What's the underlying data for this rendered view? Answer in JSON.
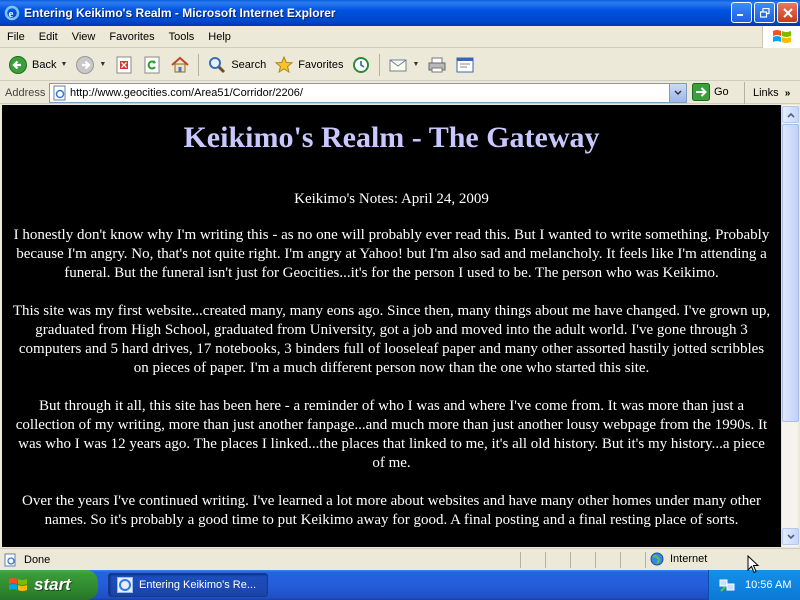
{
  "window": {
    "title": "Entering Keikimo's Realm - Microsoft Internet Explorer"
  },
  "menu": {
    "items": [
      "File",
      "Edit",
      "View",
      "Favorites",
      "Tools",
      "Help"
    ]
  },
  "toolbar": {
    "back_label": "Back",
    "search_label": "Search",
    "favorites_label": "Favorites"
  },
  "address": {
    "label": "Address",
    "url": "http://www.geocities.com/Area51/Corridor/2206/",
    "go_label": "Go",
    "links_label": "Links"
  },
  "page": {
    "heading": "Keikimo's Realm - The Gateway",
    "notes_date": "Keikimo's Notes: April 24, 2009",
    "paragraphs": [
      "I honestly don't know why I'm writing this - as no one will probably ever read this. But I wanted to write something. Probably because I'm angry. No, that's not quite right. I'm angry at Yahoo! but I'm also sad and melancholy. It feels like I'm attending a funeral. But the funeral isn't just for Geocities...it's for the person I used to be. The person who was Keikimo.",
      "This site was my first website...created many, many eons ago. Since then, many things about me have changed. I've grown up, graduated from High School, graduated from University, got a job and moved into the adult world. I've gone through 3 computers and 5 hard drives, 17 notebooks, 3 binders full of looseleaf paper and many other assorted hastily jotted scribbles on pieces of paper. I'm a much different person now than the one who started this site.",
      "But through it all, this site has been here - a reminder of who I was and where I've come from. It was more than just a collection of my writing, more than just another fanpage...and much more than just another lousy webpage from the 1990s. It was who I was 12 years ago. The places I linked...the places that linked to me, it's all old history. But it's my history...a piece of me.",
      "Over the years I've continued writing. I've learned a lot more about websites and have many other homes under many other names. So it's probably a good time to put Keikimo away for good. A final posting and a final resting place of sorts."
    ]
  },
  "status": {
    "text": "Done",
    "zone": "Internet"
  },
  "taskbar": {
    "start_label": "start",
    "task_label": "Entering Keikimo's Re...",
    "clock": "10:56 AM"
  },
  "colors": {
    "heading": "#C8C8FF",
    "page_bg": "#000000",
    "titlebar": "#0053E1"
  }
}
